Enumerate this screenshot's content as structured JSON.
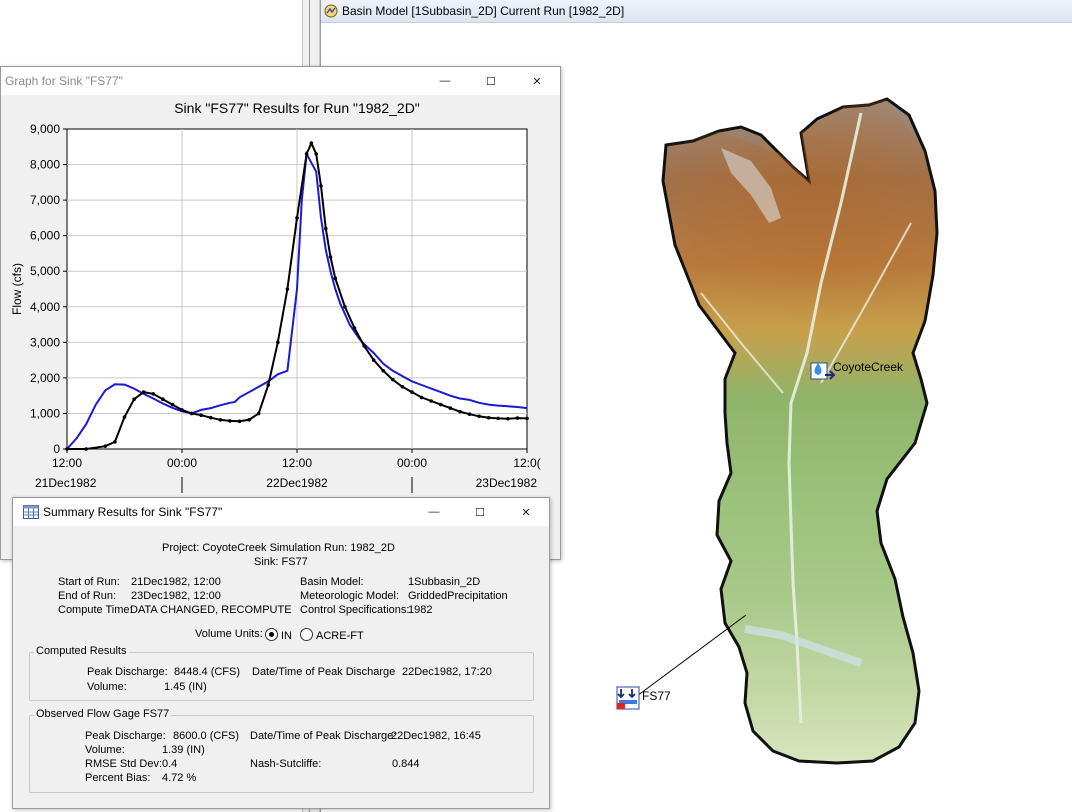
{
  "basin_window": {
    "title": "Basin Model [1Subbasin_2D] Current Run [1982_2D]"
  },
  "map": {
    "elements": [
      {
        "label": "CoyoteCreek",
        "kind": "subbasin"
      },
      {
        "label": "FS77",
        "kind": "sink"
      }
    ]
  },
  "graph_window": {
    "title": "Graph for Sink \"FS77\"",
    "buttons": {
      "minimize": "—",
      "maximize": "☐",
      "close": "✕"
    }
  },
  "summary_window": {
    "title": "Summary Results for Sink \"FS77\"",
    "buttons": {
      "minimize": "—",
      "maximize": "☐",
      "close": "✕"
    },
    "project_line": "Project: CoyoteCreek    Simulation Run: 1982_2D",
    "sink_line": "Sink: FS77",
    "start_label": "Start of Run:",
    "start_value": "21Dec1982, 12:00",
    "end_label": "End of Run:",
    "end_value": "23Dec1982, 12:00",
    "compute_label": "Compute Time:",
    "compute_value": "DATA CHANGED, RECOMPUTE",
    "basin_label": "Basin Model:",
    "basin_value": "1Subbasin_2D",
    "met_label": "Meteorologic Model:",
    "met_value": "GriddedPrecipitation",
    "control_label": "Control Specifications:",
    "control_value": "1982",
    "volume_units_label": "Volume Units:",
    "volume_options": [
      "IN",
      "ACRE-FT"
    ],
    "volume_selected": "IN",
    "computed_group": "Computed Results",
    "computed_peak_label": "Peak Discharge:",
    "computed_peak_value": "8448.4 (CFS)",
    "computed_date_label": "Date/Time of Peak Discharge",
    "computed_date_value": "22Dec1982, 17:20",
    "computed_volume_label": "Volume:",
    "computed_volume_value": "1.45 (IN)",
    "observed_group": "Observed Flow Gage FS77",
    "observed_peak_label": "Peak Discharge:",
    "observed_peak_value": "8600.0 (CFS)",
    "observed_date_label": "Date/Time of Peak Discharge:",
    "observed_date_value": "22Dec1982, 16:45",
    "observed_volume_label": "Volume:",
    "observed_volume_value": "1.39 (IN)",
    "rmse_label": "RMSE Std Dev:",
    "rmse_value": "0.4",
    "nash_label": "Nash-Sutcliffe:",
    "nash_value": "0.844",
    "bias_label": "Percent Bias:",
    "bias_value": "4.72 %"
  },
  "colors": {
    "computed_series": "#1a1ad6",
    "observed_series": "#000000"
  },
  "chart_data": {
    "type": "line",
    "title": "Sink \"FS77\" Results for Run \"1982_2D\"",
    "ylabel": "Flow (cfs)",
    "xlabel": "",
    "ylim": [
      0,
      9000
    ],
    "xlim": [
      0,
      48
    ],
    "grid": true,
    "y_ticks": [
      "0",
      "1,000",
      "2,000",
      "3,000",
      "4,000",
      "5,000",
      "6,000",
      "7,000",
      "8,000",
      "9,000"
    ],
    "x_ticks": [
      "12:00",
      "00:00",
      "12:00",
      "00:00",
      "12:0("
    ],
    "date_labels": [
      "21Dec1982",
      "22Dec1982",
      "23Dec1982"
    ],
    "series": [
      {
        "name": "",
        "color": "#1a1ad6",
        "x": [
          0,
          1,
          2,
          3,
          4,
          5,
          6,
          7,
          8,
          9,
          10,
          11,
          12,
          13,
          14,
          15,
          16,
          17,
          17.5,
          18,
          19,
          20,
          21,
          22,
          23,
          24,
          24.5,
          25,
          26,
          26.5,
          27,
          27.5,
          28,
          28.5,
          29,
          29.5,
          30,
          30.5,
          31,
          32,
          33,
          34,
          35,
          36,
          37,
          38,
          39,
          40,
          41,
          42,
          43,
          44,
          45,
          46,
          47,
          48
        ],
        "y": [
          0,
          300,
          700,
          1250,
          1650,
          1820,
          1810,
          1700,
          1550,
          1420,
          1280,
          1160,
          1060,
          1000,
          1100,
          1150,
          1230,
          1300,
          1320,
          1450,
          1600,
          1750,
          1900,
          2100,
          2200,
          4500,
          7000,
          8300,
          7800,
          6500,
          5600,
          5000,
          4500,
          4100,
          3800,
          3500,
          3300,
          3100,
          2950,
          2700,
          2400,
          2200,
          2050,
          1900,
          1800,
          1700,
          1600,
          1500,
          1420,
          1380,
          1300,
          1250,
          1220,
          1200,
          1180,
          1150
        ]
      },
      {
        "name": "",
        "color": "#000000",
        "x": [
          0,
          2,
          4,
          5,
          6,
          7,
          8,
          9,
          10,
          11,
          12,
          13,
          14,
          15,
          16,
          17,
          18,
          19,
          20,
          21,
          22,
          23,
          24,
          25,
          25.5,
          26,
          26.5,
          27,
          27.5,
          28,
          29,
          30,
          31,
          32,
          33,
          34,
          35,
          36,
          37,
          38,
          39,
          40,
          41,
          42,
          43,
          44,
          45,
          46,
          47,
          48
        ],
        "y": [
          0,
          0,
          80,
          200,
          900,
          1400,
          1600,
          1550,
          1400,
          1250,
          1100,
          1000,
          950,
          880,
          820,
          790,
          780,
          820,
          1000,
          1800,
          3000,
          4500,
          6500,
          8300,
          8600,
          8300,
          7400,
          6200,
          5400,
          4800,
          4000,
          3400,
          2900,
          2500,
          2200,
          1950,
          1750,
          1600,
          1450,
          1350,
          1250,
          1150,
          1050,
          980,
          920,
          880,
          860,
          850,
          870,
          860
        ]
      }
    ]
  }
}
